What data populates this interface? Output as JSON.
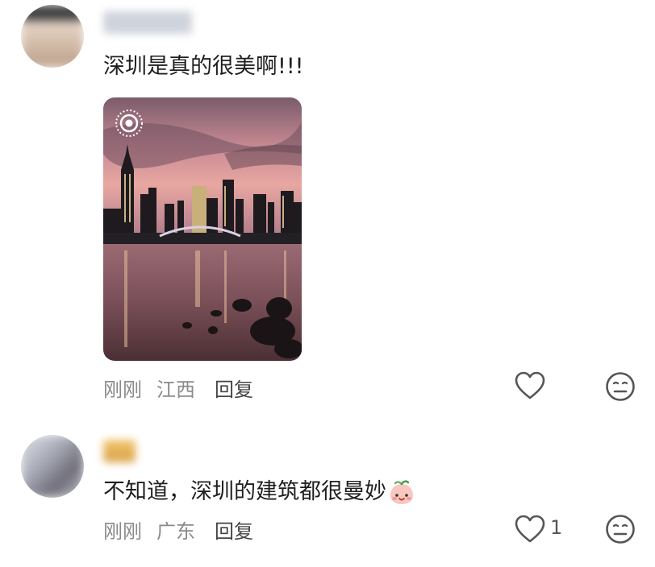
{
  "comments": [
    {
      "text": "深圳是真的很美啊!!!",
      "time": "刚刚",
      "location": "江西",
      "reply_label": "回复",
      "likes": ""
    },
    {
      "text": "不知道，深圳的建筑都很曼妙",
      "time": "刚刚",
      "location": "广东",
      "reply_label": "回复",
      "likes": "1"
    }
  ],
  "icons": {
    "like": "heart-outline-icon",
    "dislike": "meh-face-icon",
    "live_photo": "live-photo-icon",
    "emoji": "peach-face-emoji"
  },
  "colors": {
    "text": "#1f1f1f",
    "meta": "#8a8a8a",
    "icon": "#555555"
  }
}
